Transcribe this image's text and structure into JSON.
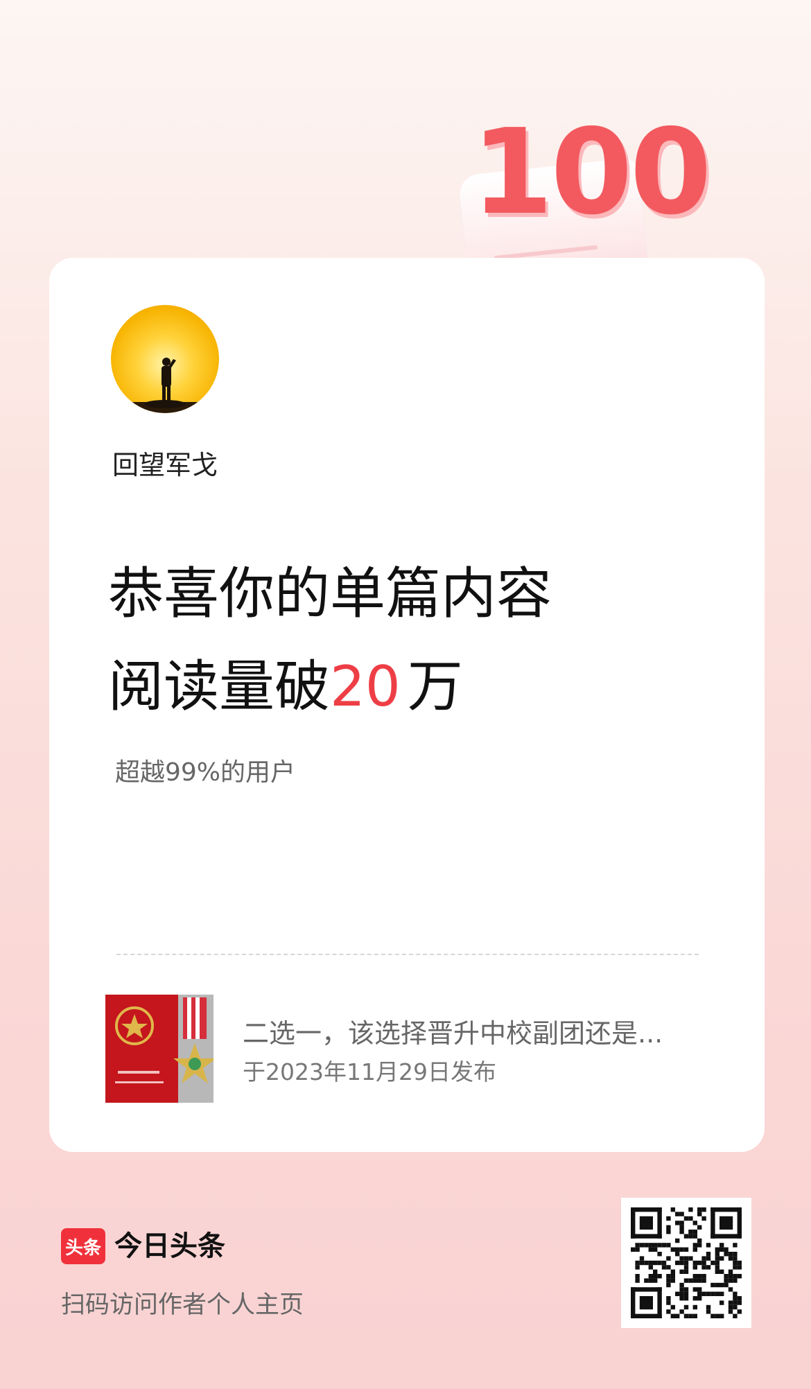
{
  "badge": {
    "number": "100"
  },
  "author": {
    "name": "回望军戈"
  },
  "headline": {
    "line1": "恭喜你的单篇内容",
    "line2_prefix": "阅读量破",
    "highlight": "20",
    "line2_suffix": "万"
  },
  "subtitle": "超越99%的用户",
  "article": {
    "title": "二选一，该选择晋升中校副团还是...",
    "date": "于2023年11月29日发布"
  },
  "footer": {
    "logo_text": "头条",
    "brand_name": "今日头条",
    "scan_text": "扫码访问作者个人主页"
  },
  "colors": {
    "accent": "#ee3e45",
    "brand_red": "#f0313b"
  }
}
